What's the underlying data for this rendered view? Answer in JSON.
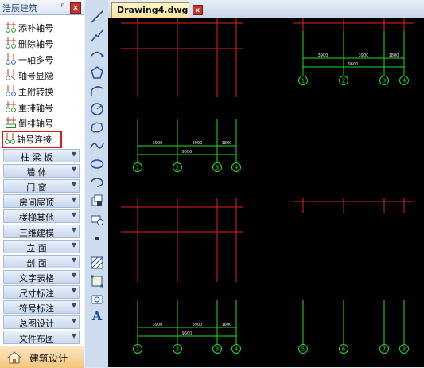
{
  "panel": {
    "title": "浩辰建筑",
    "pin_symbol": "ᵖ",
    "close_symbol": "x",
    "commands": [
      {
        "label": "添补轴号",
        "icon": "axis-add-icon"
      },
      {
        "label": "删除轴号",
        "icon": "axis-delete-icon"
      },
      {
        "label": "一轴多号",
        "icon": "axis-multi-number-icon"
      },
      {
        "label": "轴号显隐",
        "icon": "axis-show-hide-icon"
      },
      {
        "label": "主附转换",
        "icon": "axis-main-sub-convert-icon"
      },
      {
        "label": "重排轴号",
        "icon": "axis-renumber-icon"
      },
      {
        "label": "倒排轴号",
        "icon": "axis-reverse-icon"
      },
      {
        "label": "轴号连接",
        "icon": "axis-connect-icon",
        "highlighted": true
      }
    ],
    "categories": [
      "柱 梁 板",
      "墙    体",
      "门    窗",
      "房间屋顶",
      "楼梯其他",
      "三维建模",
      "立    面",
      "剖    面",
      "文字表格",
      "尺寸标注",
      "符号标注",
      "总图设计",
      "文件布图"
    ],
    "bottom_tab": "建筑设计"
  },
  "toolbar": {
    "tools": [
      "line-icon",
      "polyline-icon",
      "arc-icon",
      "polygon-icon",
      "pline-arc-icon",
      "circle-icon",
      "revision-cloud-icon",
      "spline-icon",
      "ellipse-icon",
      "ellipse-arc-icon",
      "insert-block-icon",
      "make-block-icon",
      "point-icon",
      "hatch-icon",
      "region-icon",
      "table-icon",
      "text-icon"
    ],
    "text_tool_glyph": "A"
  },
  "document": {
    "tab_label": "Drawing4.dwg",
    "close_symbol": "x"
  },
  "drawing": {
    "colors": {
      "background": "#000000",
      "axis_red": "#e02020",
      "axis_green": "#22dd22",
      "text": "#e6e6e6"
    },
    "blocks": [
      {
        "id": "top-left",
        "dimensions": [
          "3900",
          "3900",
          "1800"
        ],
        "total": "9600",
        "axis_labels": [
          "1",
          "2",
          "3",
          "4"
        ]
      },
      {
        "id": "top-right",
        "dimensions": [
          "3900",
          "3900",
          "1800"
        ],
        "total": "9600",
        "axis_labels": [
          "1",
          "2",
          "3",
          "4"
        ]
      },
      {
        "id": "bottom-left",
        "dimensions": [
          "3900",
          "3900",
          "1800"
        ],
        "total": "9600",
        "axis_labels": [
          "1",
          "2",
          "3",
          "4"
        ]
      },
      {
        "id": "bottom-right",
        "axis_labels": [
          "5",
          "6",
          "7",
          "8"
        ]
      }
    ]
  }
}
